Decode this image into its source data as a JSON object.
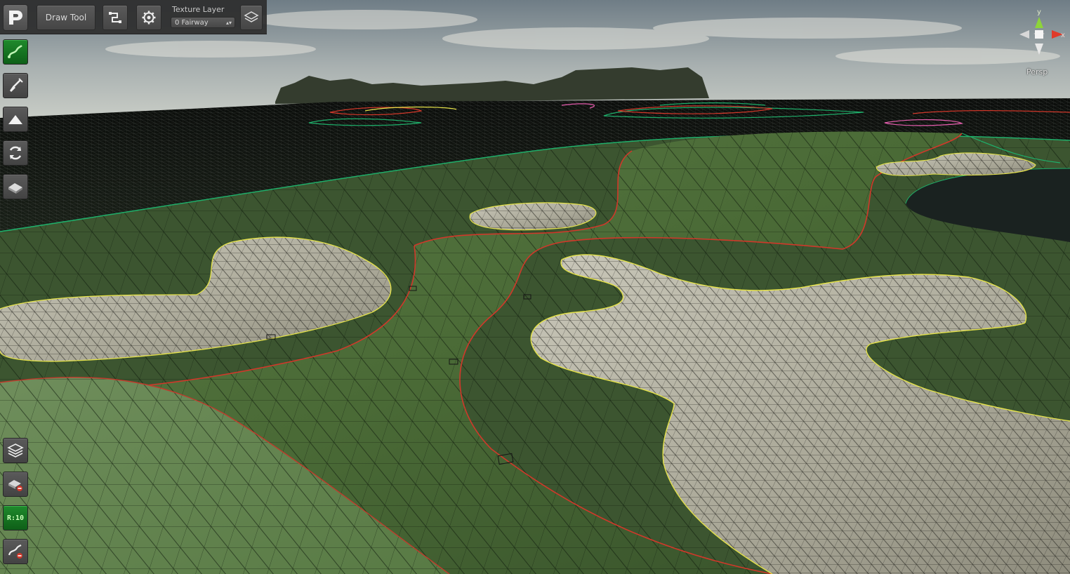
{
  "toolbar": {
    "draw_tool_label": "Draw Tool",
    "texture_layer_label": "Texture Layer",
    "texture_layer_value": "0 Fairway"
  },
  "side_tools": {
    "top": [
      "spline-draw-icon",
      "shovel-icon",
      "terrain-raise-icon",
      "rotate-icon",
      "paint-roller-icon"
    ],
    "bottom": [
      "layers-icon",
      "eraser-icon",
      "ratio-icon",
      "remove-spline-icon"
    ],
    "ratio_label": "R:10"
  },
  "gizmo": {
    "y_label": "y",
    "x_label": "x",
    "projection_label": "Persp"
  },
  "colors": {
    "active_tool": "#12741f",
    "fairway": "#4f6e3a",
    "rough": "#3f5a2d",
    "bunker_sand": "#bdbaaa",
    "fairway_outline": "#d0382a",
    "bunker_outline": "#e5e24a",
    "rough_outline": "#1fae6a"
  }
}
